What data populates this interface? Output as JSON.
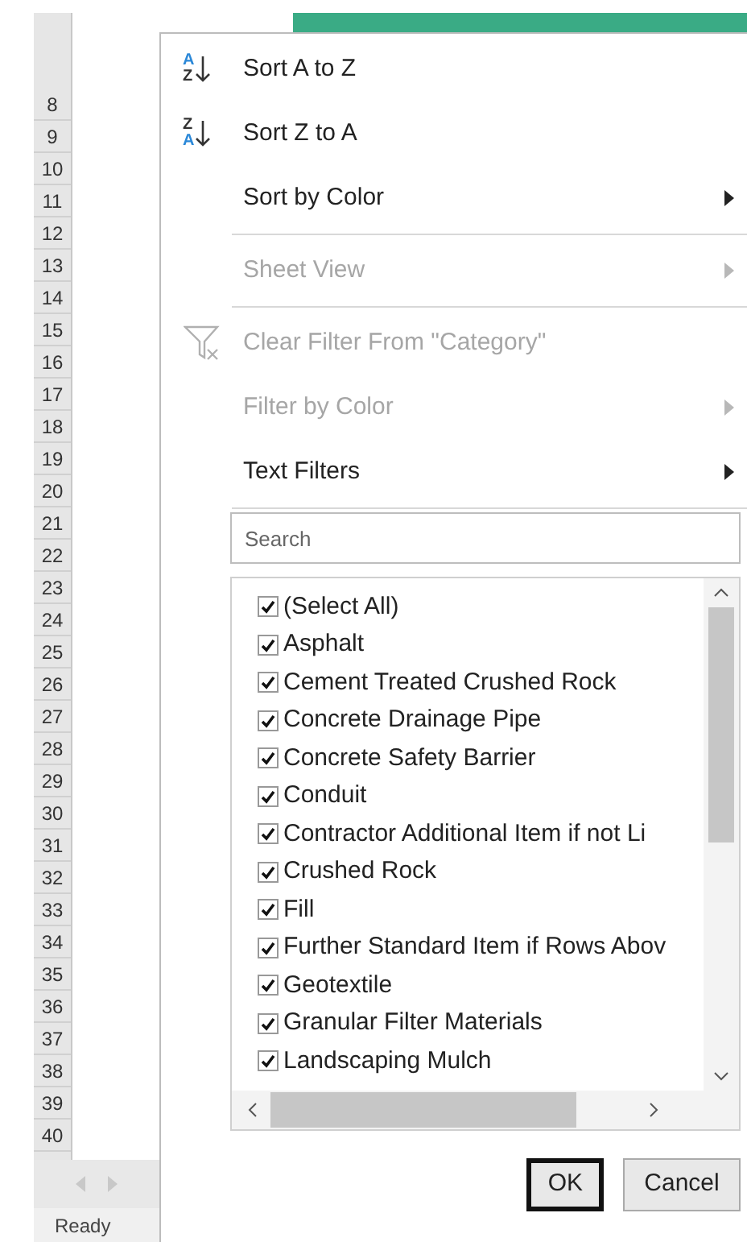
{
  "sheet": {
    "row_numbers": [
      "8",
      "9",
      "10",
      "11",
      "12",
      "13",
      "14",
      "15",
      "16",
      "17",
      "18",
      "19",
      "20",
      "21",
      "22",
      "23",
      "24",
      "25",
      "26",
      "27",
      "28",
      "29",
      "30",
      "31",
      "32",
      "33",
      "34",
      "35",
      "36",
      "37",
      "38",
      "39",
      "40"
    ],
    "status": "Ready"
  },
  "menu": {
    "items": [
      {
        "kind": "sort",
        "icon_top": "A",
        "icon_bottom": "Z",
        "top_highlighted": true,
        "label": "Sort A to Z",
        "disabled": false
      },
      {
        "kind": "sort",
        "icon_top": "Z",
        "icon_bottom": "A",
        "top_highlighted": false,
        "label": "Sort Z to A",
        "disabled": false
      },
      {
        "kind": "submenu",
        "label": "Sort by Color",
        "disabled": false
      },
      {
        "kind": "separator"
      },
      {
        "kind": "submenu",
        "label": "Sheet View",
        "disabled": true
      },
      {
        "kind": "separator"
      },
      {
        "kind": "clear_filter",
        "label": "Clear Filter From \"Category\"",
        "disabled": true
      },
      {
        "kind": "submenu",
        "label": "Filter by Color",
        "disabled": true
      },
      {
        "kind": "submenu",
        "label": "Text Filters",
        "disabled": false
      },
      {
        "kind": "separator"
      }
    ]
  },
  "search": {
    "placeholder": "Search"
  },
  "filter_list": {
    "items": [
      {
        "label": "(Select All)",
        "checked": true
      },
      {
        "label": "Asphalt",
        "checked": true
      },
      {
        "label": "Cement Treated Crushed Rock",
        "checked": true
      },
      {
        "label": "Concrete Drainage Pipe",
        "checked": true
      },
      {
        "label": "Concrete Safety Barrier",
        "checked": true
      },
      {
        "label": "Conduit",
        "checked": true
      },
      {
        "label": "Contractor Additional Item if not Li",
        "checked": true
      },
      {
        "label": "Crushed Rock",
        "checked": true
      },
      {
        "label": "Fill",
        "checked": true
      },
      {
        "label": "Further Standard Item if Rows Abov",
        "checked": true
      },
      {
        "label": "Geotextile",
        "checked": true
      },
      {
        "label": "Granular Filter Materials",
        "checked": true
      },
      {
        "label": "Landscaping Mulch",
        "checked": true
      }
    ]
  },
  "buttons": [
    {
      "label": "OK",
      "default": true
    },
    {
      "label": "Cancel",
      "default": false
    }
  ]
}
